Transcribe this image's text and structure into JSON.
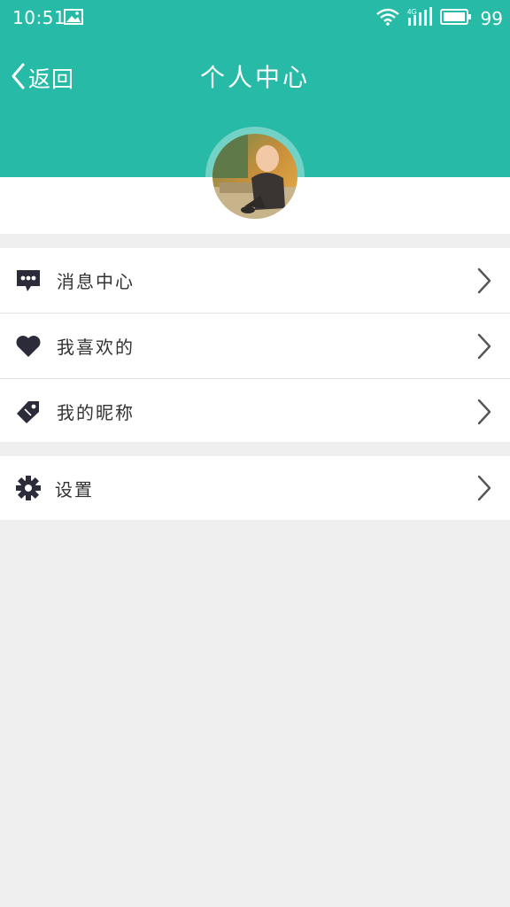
{
  "status_bar": {
    "time": "10:51",
    "battery": "99",
    "network": "4G",
    "icons": [
      "image-icon",
      "wifi-icon",
      "signal-icon",
      "battery-icon"
    ]
  },
  "header": {
    "back_label": "返回",
    "title": "个人中心",
    "accent_color": "#27bba7"
  },
  "profile": {
    "avatar": "avatar"
  },
  "menu": {
    "group1": [
      {
        "label": "消息中心",
        "icon": "chat-bubble-icon"
      },
      {
        "label": "我喜欢的",
        "icon": "heart-icon"
      },
      {
        "label": "我的昵称",
        "icon": "tag-icon"
      }
    ],
    "group2": [
      {
        "label": "设置",
        "icon": "gear-icon"
      }
    ]
  }
}
